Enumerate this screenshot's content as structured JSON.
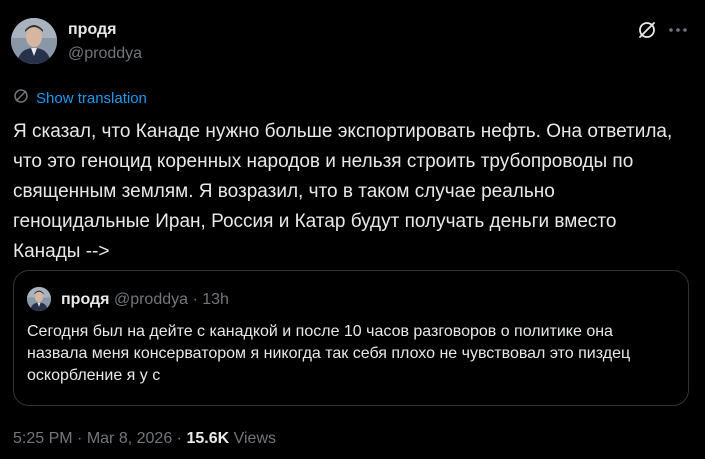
{
  "author": {
    "display_name": "продя",
    "handle": "@proddya"
  },
  "icons": {
    "grok": "grok-slash-icon",
    "more": "more-dots-icon",
    "translate": "translate-icon"
  },
  "translate": {
    "label": "Show translation"
  },
  "post": {
    "text": "Я сказал, что Канаде нужно больше экспортировать нефть. Она ответила, что это геноцид коренных народов и нельзя строить трубопроводы по священным землям. Я возразил, что в таком случае реально геноцидальные Иран, Россия и Катар будут получать деньги вместо Канады -->"
  },
  "quote": {
    "display_name": "продя",
    "handle": "@proddya",
    "separator": "·",
    "time": "13h",
    "text": "Сегодня был на дейте с канадкой и после 10 часов разговоров о политике она назвала меня консерватором я никогда так себя плохо не чувствовал это пиздец оскорбление я у с"
  },
  "meta": {
    "time": "5:25 PM",
    "separator": "·",
    "date": "Mar 8, 2026",
    "views_count": "15.6K",
    "views_label": "Views"
  },
  "colors": {
    "background": "#000000",
    "text": "#e7e9ea",
    "muted": "#71767b",
    "link": "#1d9bf0",
    "border": "#2f3336"
  }
}
